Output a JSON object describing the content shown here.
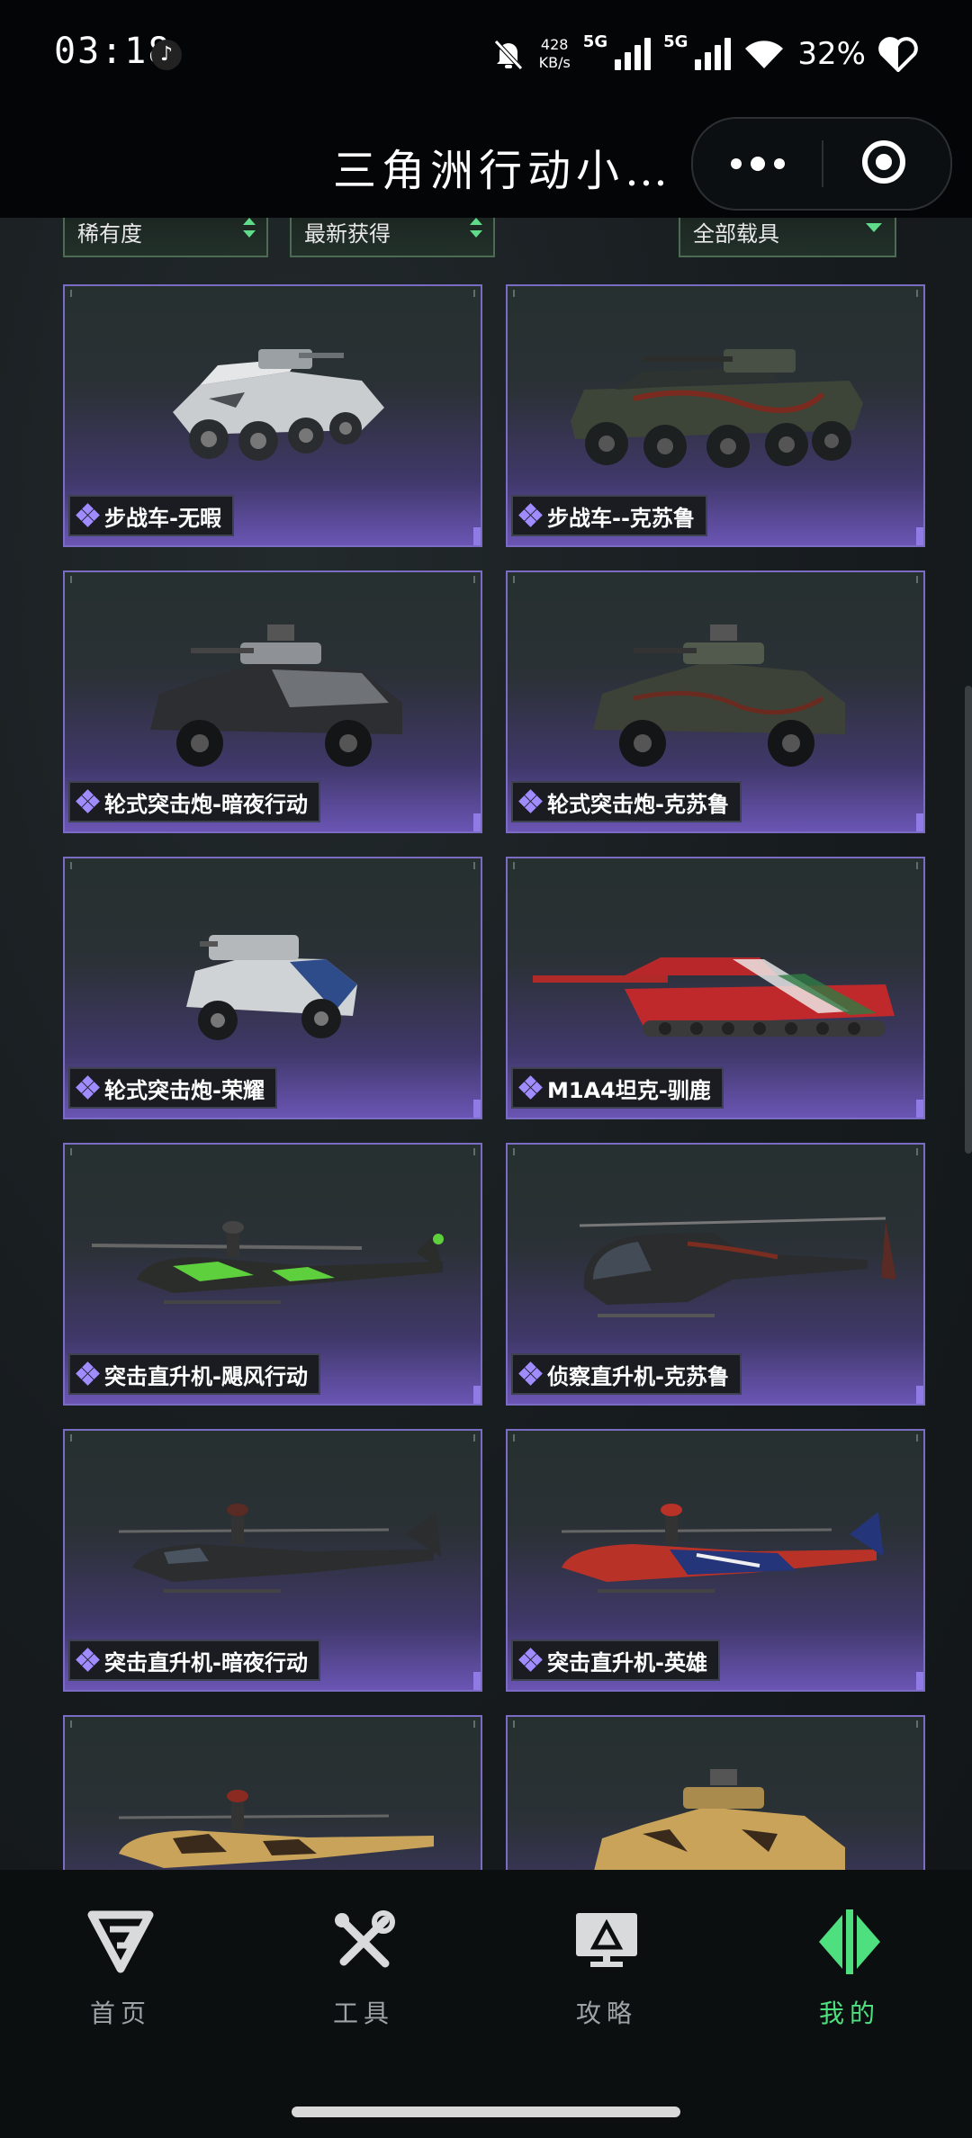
{
  "status_bar": {
    "time": "03:18",
    "net_speed_value": "428",
    "net_speed_unit": "KB/s",
    "signal1": "5G",
    "signal2": "5G",
    "battery": "32%"
  },
  "title_bar": {
    "title": "三角洲行动小…"
  },
  "filters": {
    "rarity": "稀有度",
    "sort": "最新获得",
    "vehicle_type": "全部载具"
  },
  "vehicles": [
    {
      "name": "步战车-无暇"
    },
    {
      "name": "步战车--克苏鲁"
    },
    {
      "name": "轮式突击炮-暗夜行动"
    },
    {
      "name": "轮式突击炮-克苏鲁"
    },
    {
      "name": "轮式突击炮-荣耀"
    },
    {
      "name": "M1A4坦克-驯鹿"
    },
    {
      "name": "突击直升机-飓风行动"
    },
    {
      "name": "侦察直升机-克苏鲁"
    },
    {
      "name": "突击直升机-暗夜行动"
    },
    {
      "name": "突击直升机-英雄"
    }
  ],
  "tabs": [
    {
      "label": "首页",
      "icon": "delta-logo-icon"
    },
    {
      "label": "工具",
      "icon": "tools-icon"
    },
    {
      "label": "攻略",
      "icon": "guide-monitor-icon"
    },
    {
      "label": "我的",
      "icon": "profile-logo-icon",
      "active": true
    }
  ],
  "colors": {
    "accent": "#4ee07f",
    "card_purple": "#6a55b4",
    "rarity_icon": "#a08bff"
  }
}
